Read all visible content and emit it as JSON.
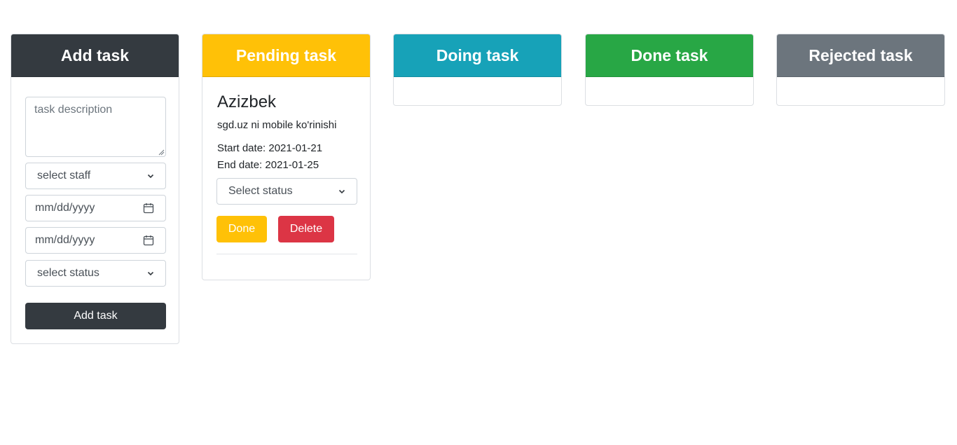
{
  "columns": {
    "add": {
      "title": "Add task",
      "color": "#343a40"
    },
    "pending": {
      "title": "Pending task",
      "color": "#ffc107"
    },
    "doing": {
      "title": "Doing task",
      "color": "#17a2b8"
    },
    "done": {
      "title": "Done task",
      "color": "#28a745"
    },
    "rejected": {
      "title": "Rejected task",
      "color": "#6c757d"
    }
  },
  "form": {
    "description_placeholder": "task description",
    "staff_select": "select staff",
    "start_date": "mm/dd/yyyy",
    "end_date": "mm/dd/yyyy",
    "status_select": "select status",
    "submit_label": "Add task"
  },
  "pending_tasks": [
    {
      "name": "Azizbek",
      "description": "sgd.uz ni mobile ko'rinishi",
      "start": "Start date: 2021-01-21",
      "end": "End date: 2021-01-25",
      "status_select": "Select status",
      "done_label": "Done",
      "delete_label": "Delete"
    }
  ],
  "icons": {
    "chevron": "chevron-down-icon",
    "calendar": "calendar-icon"
  }
}
